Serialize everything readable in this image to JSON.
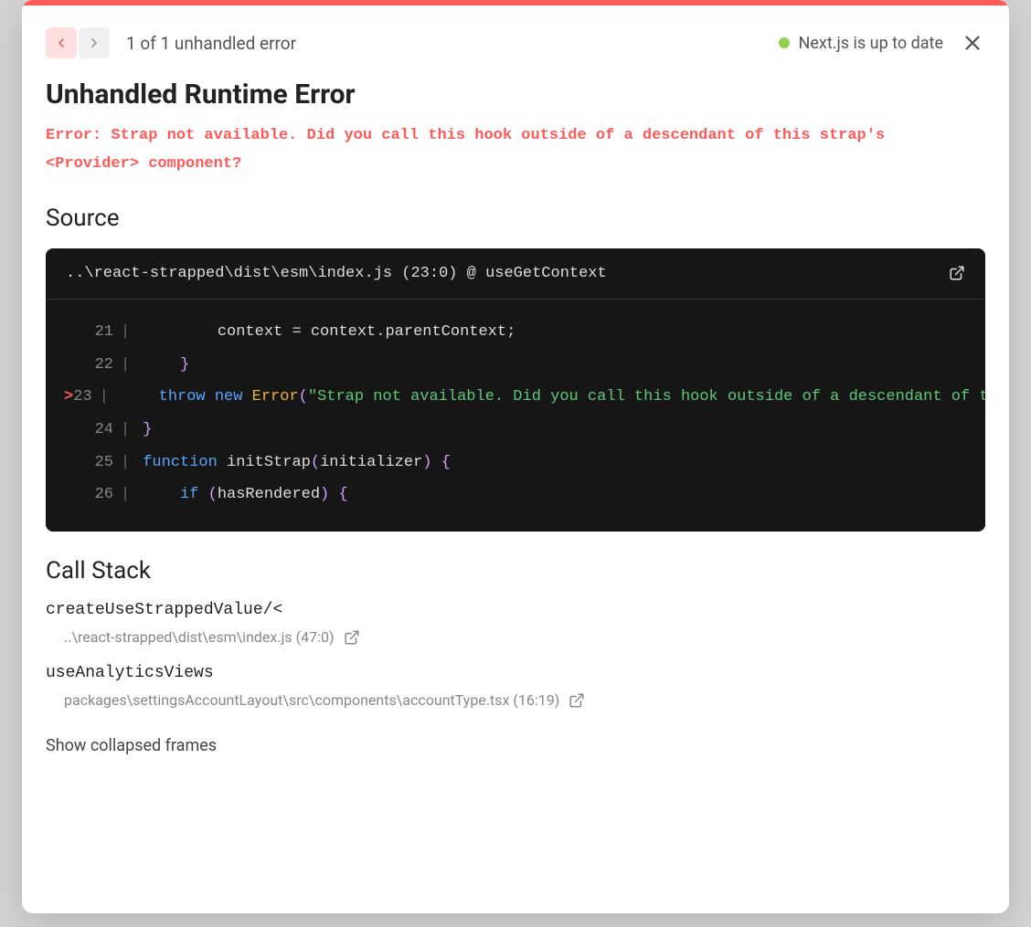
{
  "header": {
    "counter": "1 of 1 unhandled error",
    "status": "Next.js is up to date"
  },
  "title": "Unhandled Runtime Error",
  "error_message": "Error: Strap not available. Did you call this hook outside of a descendant of this strap's <Provider> component?",
  "source": {
    "heading": "Source",
    "path": "..\\react-strapped\\dist\\esm\\index.js (23:0) @ useGetContext",
    "lines": [
      {
        "num": "21",
        "mark": "",
        "tokens": [
          {
            "t": "plain",
            "v": "        context "
          },
          {
            "t": "pun",
            "v": "="
          },
          {
            "t": "plain",
            "v": " context"
          },
          {
            "t": "pun",
            "v": "."
          },
          {
            "t": "plain",
            "v": "parentContext"
          },
          {
            "t": "pun",
            "v": ";"
          }
        ]
      },
      {
        "num": "22",
        "mark": "",
        "tokens": [
          {
            "t": "plain",
            "v": "    "
          },
          {
            "t": "par",
            "v": "}"
          }
        ]
      },
      {
        "num": "23",
        "mark": ">",
        "tokens": [
          {
            "t": "plain",
            "v": "    "
          },
          {
            "t": "kw",
            "v": "throw"
          },
          {
            "t": "plain",
            "v": " "
          },
          {
            "t": "kw",
            "v": "new"
          },
          {
            "t": "plain",
            "v": " "
          },
          {
            "t": "cls",
            "v": "Error"
          },
          {
            "t": "par",
            "v": "("
          },
          {
            "t": "str",
            "v": "\"Strap not available. Did you call this hook outside of a descendant of this strap's <Provider> component?\""
          },
          {
            "t": "par",
            "v": ")"
          },
          {
            "t": "pun",
            "v": ";"
          }
        ]
      },
      {
        "num": "24",
        "mark": "",
        "tokens": [
          {
            "t": "par",
            "v": "}"
          }
        ]
      },
      {
        "num": "25",
        "mark": "",
        "tokens": [
          {
            "t": "kw",
            "v": "function"
          },
          {
            "t": "plain",
            "v": " initStrap"
          },
          {
            "t": "par",
            "v": "("
          },
          {
            "t": "plain",
            "v": "initializer"
          },
          {
            "t": "par",
            "v": ")"
          },
          {
            "t": "plain",
            "v": " "
          },
          {
            "t": "par",
            "v": "{"
          }
        ]
      },
      {
        "num": "26",
        "mark": "",
        "tokens": [
          {
            "t": "plain",
            "v": "    "
          },
          {
            "t": "kw",
            "v": "if"
          },
          {
            "t": "plain",
            "v": " "
          },
          {
            "t": "par",
            "v": "("
          },
          {
            "t": "plain",
            "v": "hasRendered"
          },
          {
            "t": "par",
            "v": ")"
          },
          {
            "t": "plain",
            "v": " "
          },
          {
            "t": "par",
            "v": "{"
          }
        ]
      }
    ]
  },
  "call_stack": {
    "heading": "Call Stack",
    "frames": [
      {
        "fn": "createUseStrappedValue/<",
        "loc": "..\\react-strapped\\dist\\esm\\index.js (47:0)"
      },
      {
        "fn": "useAnalyticsViews",
        "loc": "packages\\settingsAccountLayout\\src\\components\\accountType.tsx (16:19)"
      }
    ],
    "show_collapsed": "Show collapsed frames"
  }
}
